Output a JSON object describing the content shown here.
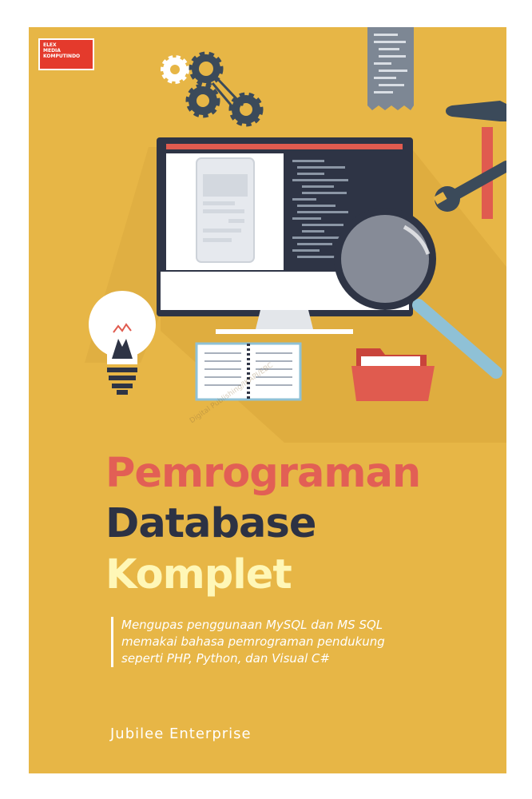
{
  "publisher": {
    "logo_text": "ELEX MEDIA KOMPUTINDO"
  },
  "book": {
    "title_line1": "Pemrograman",
    "title_line2": "Database",
    "title_line3": "Komplet",
    "subtitle_lines": [
      "Mengupas penggunaan MySQL dan MS SQL",
      "memakai bahasa pemrograman pendukung",
      "seperti PHP, Python, dan Visual C#"
    ],
    "author": "Jubilee Enterprise",
    "watermark": "Digital Publishing/IKAPI/EBC"
  },
  "colors": {
    "background": "#E7B646",
    "title_line1": "#E25F55",
    "title_line2": "#2D3244",
    "title_line3": "#FFF7B7",
    "publisher_logo": "#E43A2C"
  },
  "illustration_icons": [
    "gears-icon",
    "code-document-icon",
    "hammer-icon",
    "wrench-icon",
    "monitor-icon",
    "magnifier-icon",
    "light-bulb-icon",
    "notebook-icon",
    "folder-icon"
  ]
}
